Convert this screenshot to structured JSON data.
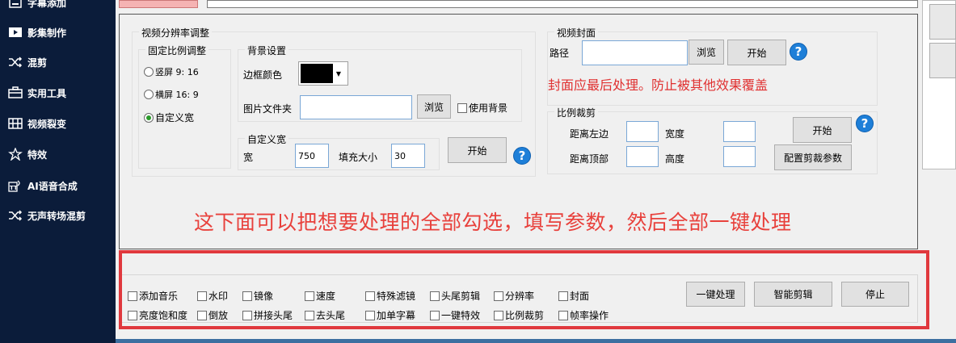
{
  "sidebar": {
    "items": [
      {
        "label": "字幕添加",
        "icon": "subtitle-icon"
      },
      {
        "label": "影集制作",
        "icon": "play-icon"
      },
      {
        "label": "混剪",
        "icon": "shuffle-icon"
      },
      {
        "label": "实用工具",
        "icon": "toolbox-icon"
      },
      {
        "label": "视频裂变",
        "icon": "film-icon"
      },
      {
        "label": "特效",
        "icon": "sparkle-icon"
      },
      {
        "label": "AI语音合成",
        "icon": "ai-voice-icon"
      },
      {
        "label": "无声转场混剪",
        "icon": "shuffle-icon"
      }
    ]
  },
  "resolution": {
    "title": "视频分辨率调整",
    "fixed_ratio_title": "固定比例调整",
    "options": [
      "竖屏 9: 16",
      "横屏 16: 9",
      "自定义宽"
    ],
    "selected": "自定义宽",
    "background": {
      "title": "背景设置",
      "border_color_label": "边框颜色",
      "border_color": "#000000",
      "image_folder_label": "图片文件夹",
      "image_folder_value": "",
      "browse_label": "浏览",
      "use_bg_label": "使用背景"
    },
    "custom": {
      "title": "自定义宽",
      "width_label": "宽",
      "width_value": "750",
      "fill_label": "填充大小",
      "fill_value": "30",
      "start_label": "开始"
    }
  },
  "cover": {
    "title": "视频封面",
    "path_label": "路径",
    "path_value": "",
    "browse_label": "浏览",
    "start_label": "开始",
    "warning": "封面应最后处理。防止被其他效果覆盖"
  },
  "crop": {
    "title": "比例裁剪",
    "left_label": "距离左边",
    "width_label": "宽度",
    "top_label": "距离顶部",
    "height_label": "高度",
    "start_label": "开始",
    "config_label": "配置剪裁参数"
  },
  "instruction": "这下面可以把想要处理的全部勾选，填写参数，然后全部一键处理",
  "options": {
    "row1": [
      "添加音乐",
      "水印",
      "镜像",
      "速度",
      "特殊滤镜",
      "头尾剪辑",
      "分辨率",
      "封面"
    ],
    "row2": [
      "亮度饱和度",
      "倒放",
      "拼接头尾",
      "去头尾",
      "加单字幕",
      "一键特效",
      "比例裁剪",
      "帧率操作"
    ]
  },
  "actions": {
    "one_click": "一键处理",
    "smart_cut": "智能剪辑",
    "stop": "停止"
  },
  "help_glyph": "?",
  "colors": {
    "sidebar_bg": "#0b1c3a",
    "accent_red": "#e0383d",
    "help_blue": "#1e7fd8"
  }
}
